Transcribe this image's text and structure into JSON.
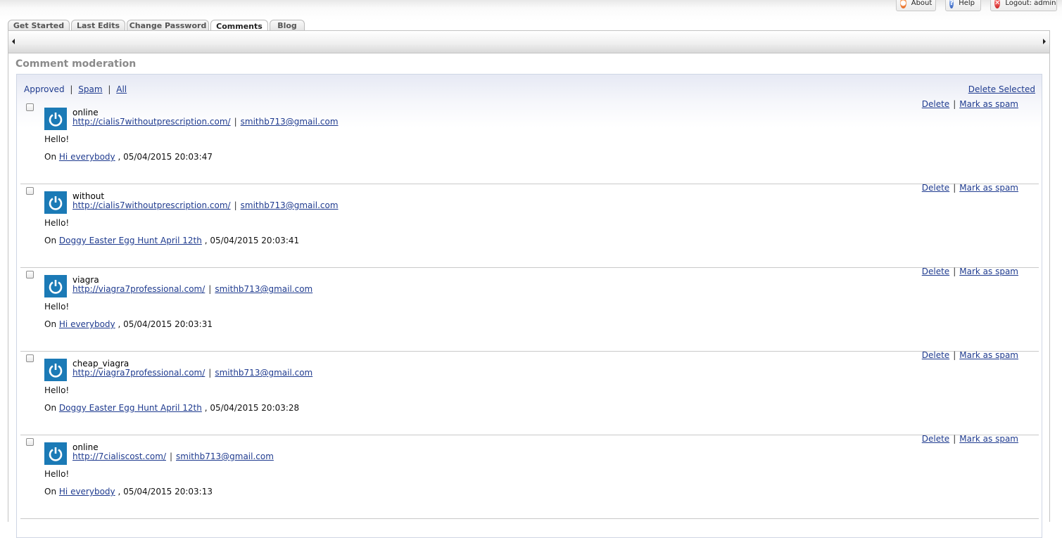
{
  "top_buttons": {
    "about": "About",
    "help": "Help",
    "logout": "Logout: admin"
  },
  "tabs": [
    "Get Started",
    "Last Edits",
    "Change Password",
    "Comments",
    "Blog"
  ],
  "active_tab": "Comments",
  "page_title": "Comment moderation",
  "filters": {
    "approved": "Approved",
    "spam": "Spam",
    "all": "All",
    "separator": "|"
  },
  "delete_selected": "Delete Selected",
  "comment_actions": {
    "delete": "Delete",
    "mark_spam": "Mark as spam",
    "separator": "|"
  },
  "on_label": "On",
  "comments": [
    {
      "author": "online",
      "website": "http://cialis7withoutprescription.com/",
      "email": "smithb713@gmail.com",
      "body": "Hello!",
      "post_title": "Hi everybody",
      "date": ", 05/04/2015 20:03:47"
    },
    {
      "author": "without",
      "website": "http://cialis7withoutprescription.com/",
      "email": "smithb713@gmail.com",
      "body": "Hello!",
      "post_title": "Doggy Easter Egg Hunt April 12th",
      "date": ", 05/04/2015 20:03:41"
    },
    {
      "author": "viagra",
      "website": "http://viagra7professional.com/",
      "email": "smithb713@gmail.com",
      "body": "Hello!",
      "post_title": "Hi everybody",
      "date": ", 05/04/2015 20:03:31"
    },
    {
      "author": "cheap_viagra",
      "website": "http://viagra7professional.com/",
      "email": "smithb713@gmail.com",
      "body": "Hello!",
      "post_title": "Doggy Easter Egg Hunt April 12th",
      "date": ", 05/04/2015 20:03:28"
    },
    {
      "author": "online",
      "website": "http://7cialiscost.com/",
      "email": "smithb713@gmail.com",
      "body": "Hello!",
      "post_title": "Hi everybody",
      "date": ", 05/04/2015 20:03:13"
    }
  ],
  "colors": {
    "link": "#1f3b8f",
    "avatar": "#1b7ab6",
    "heading": "#8a8a8a"
  }
}
